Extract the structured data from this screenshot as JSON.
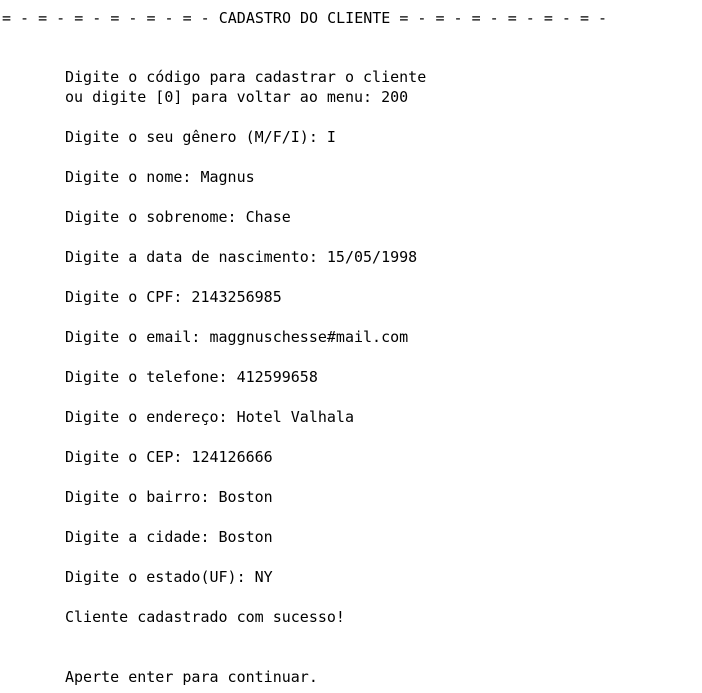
{
  "console": {
    "header": "= - = - = - = - = - = - CADASTRO DO CLIENTE = - = - = - = - = - = -",
    "lines": [
      "Digite o código para cadastrar o cliente",
      "ou digite [0] para voltar ao menu: 200",
      "Digite o seu gênero (M/F/I): I",
      "Digite o nome: Magnus",
      "Digite o sobrenome: Chase",
      "Digite a data de nascimento: 15/05/1998",
      "Digite o CPF: 2143256985",
      "Digite o email: maggnuschesse#mail.com",
      "Digite o telefone: 412599658",
      "Digite o endereço: Hotel Valhala",
      "Digite o CEP: 124126666",
      "Digite o bairro: Boston",
      "Digite a cidade: Boston",
      "Digite o estado(UF): NY",
      "Cliente cadastrado com sucesso!",
      "Aperte enter para continuar."
    ]
  }
}
